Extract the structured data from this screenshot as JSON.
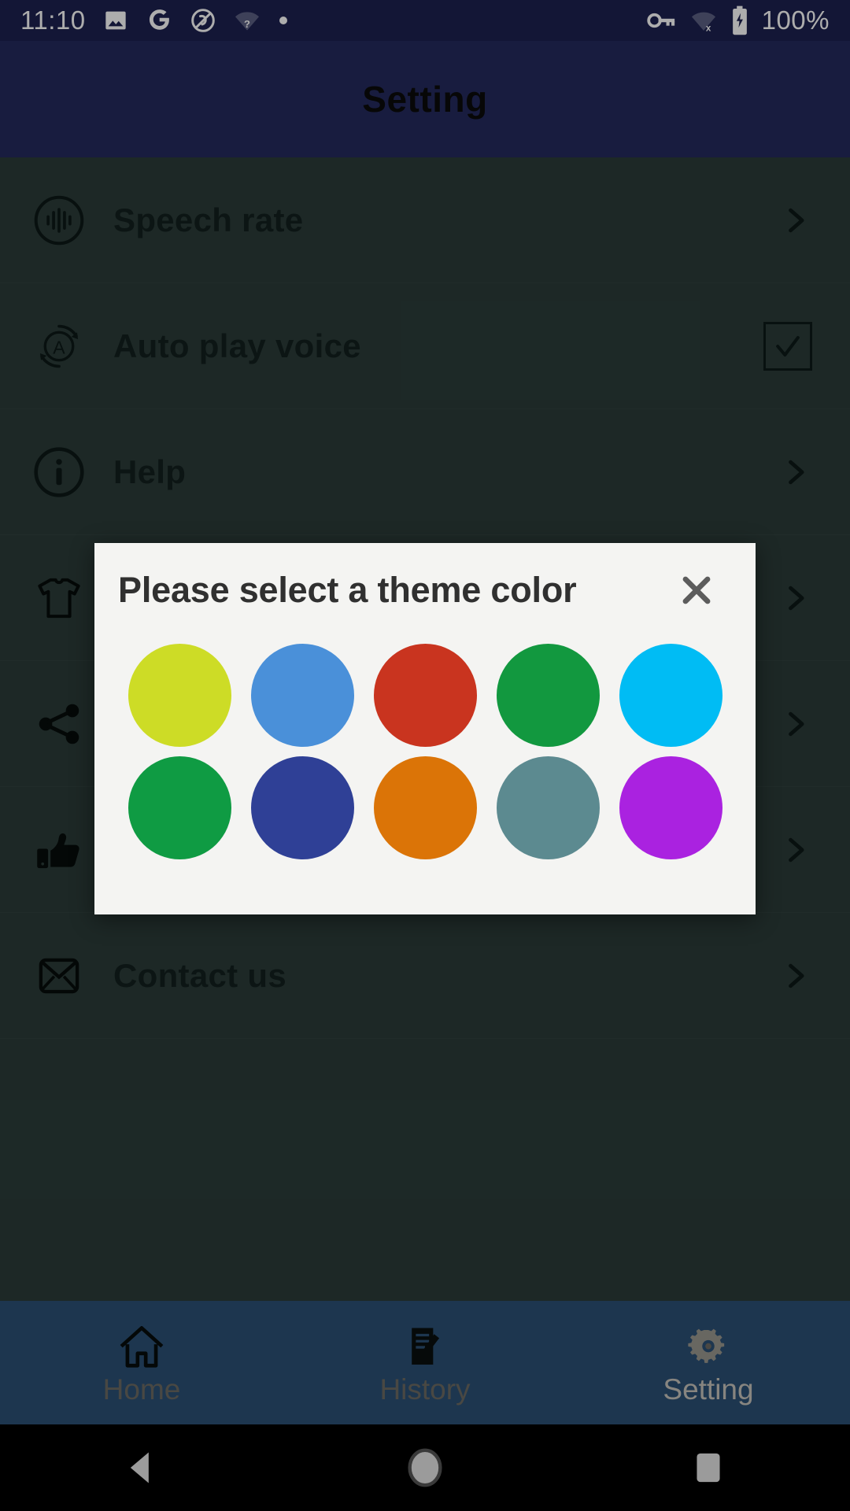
{
  "status_bar": {
    "time": "11:10",
    "battery_percent": "100%",
    "left_icons": [
      "photos-icon",
      "google-icon",
      "no-sound-icon",
      "wifi-question-icon",
      "dot-icon"
    ],
    "right_icons": [
      "vpn-key-icon",
      "wifi-off-icon",
      "battery-charging-icon"
    ],
    "background_color": "#1d2150",
    "foreground_color": "#ffffff"
  },
  "app_bar": {
    "title": "Setting",
    "background_color": "#242a5e",
    "title_color": "#0b0b0b"
  },
  "settings_list": {
    "background_color": "#2b3c39",
    "items": [
      {
        "label": "Speech rate",
        "icon": "waveform-circle-icon",
        "trailing": "chevron-right-icon"
      },
      {
        "label": "Auto play voice",
        "icon": "auto-replay-icon",
        "trailing": "checkbox-checked-icon"
      },
      {
        "label": "Help",
        "icon": "info-circle-icon",
        "trailing": "chevron-right-icon"
      },
      {
        "label": "",
        "icon": "tshirt-icon",
        "trailing": "chevron-right-icon"
      },
      {
        "label": "",
        "icon": "share-icon",
        "trailing": "chevron-right-icon"
      },
      {
        "label": "",
        "icon": "thumbs-up-icon",
        "trailing": "chevron-right-icon"
      },
      {
        "label": "Contact us",
        "icon": "envelope-icon",
        "trailing": "chevron-right-icon"
      }
    ]
  },
  "dialog": {
    "title": "Please select a theme color",
    "close_icon": "close-icon",
    "background_color": "#f4f4f2",
    "title_color": "#303030",
    "close_color": "#5c5c5c",
    "swatches": [
      {
        "name": "yellow-green",
        "color": "#cddc26"
      },
      {
        "name": "blue",
        "color": "#4a90d9"
      },
      {
        "name": "red",
        "color": "#c9341f"
      },
      {
        "name": "green",
        "color": "#12983f"
      },
      {
        "name": "cyan",
        "color": "#00bcf4"
      },
      {
        "name": "green-2",
        "color": "#0f9b43"
      },
      {
        "name": "indigo",
        "color": "#2f4096"
      },
      {
        "name": "orange",
        "color": "#db7407"
      },
      {
        "name": "slate-teal",
        "color": "#5c8a90"
      },
      {
        "name": "purple",
        "color": "#aa22e0"
      }
    ]
  },
  "bottom_nav": {
    "background_color": "#2b5075",
    "items": [
      {
        "label": "Home",
        "icon": "home-icon",
        "active": false
      },
      {
        "label": "History",
        "icon": "history-icon",
        "active": false
      },
      {
        "label": "Setting",
        "icon": "gear-icon",
        "active": true
      }
    ]
  },
  "android_nav": {
    "background_color": "#000000",
    "buttons": [
      "back-icon",
      "home-circle-icon",
      "recents-icon"
    ]
  }
}
